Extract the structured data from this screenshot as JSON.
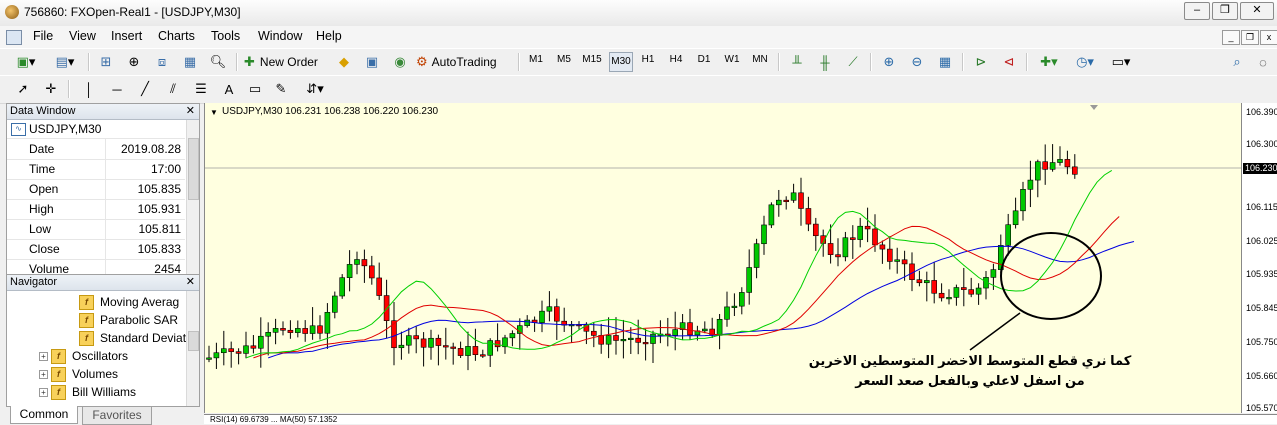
{
  "window": {
    "title": "756860: FXOpen-Real1 - [USDJPY,M30]"
  },
  "menu": [
    "File",
    "View",
    "Insert",
    "Charts",
    "Tools",
    "Window",
    "Help"
  ],
  "toolbar": {
    "new_order": "New Order",
    "autotrading": "AutoTrading"
  },
  "timeframes": [
    "M1",
    "M5",
    "M15",
    "M30",
    "H1",
    "H4",
    "D1",
    "W1",
    "MN"
  ],
  "selected_timeframe": "M30",
  "drawing_tools": {
    "text": "A",
    "arrow_down_glyph": "▾"
  },
  "data_window": {
    "title": "Data Window",
    "symbol": "USDJPY,M30",
    "rows": [
      {
        "label": "Date",
        "value": "2019.08.28"
      },
      {
        "label": "Time",
        "value": "17:00"
      },
      {
        "label": "Open",
        "value": "105.835"
      },
      {
        "label": "High",
        "value": "105.931"
      },
      {
        "label": "Low",
        "value": "105.811"
      },
      {
        "label": "Close",
        "value": "105.833"
      },
      {
        "label": "Volume",
        "value": "2454"
      }
    ]
  },
  "navigator": {
    "title": "Navigator",
    "items": [
      "Moving Averag",
      "Parabolic SAR",
      "Standard Deviat",
      "Oscillators",
      "Volumes",
      "Bill Williams"
    ],
    "tabs": [
      "Common",
      "Favorites"
    ]
  },
  "chart": {
    "info": "USDJPY,M30  106.231 106.238 106.220 106.230",
    "price_labels": [
      "106.390",
      "106.300",
      "106.230",
      "106.115",
      "106.025",
      "105.935",
      "105.845",
      "105.750",
      "105.660",
      "105.570"
    ],
    "current_price": "106.230",
    "annotation_line1": "كما نري قطع المتوسط الاخضر المتوسطين الاخرين",
    "annotation_line2": "من اسفل لاعلي وبالفعل صعد السعر",
    "rsi_strip": "RSI(14) 69.6739 ... MA(50) 57.1352"
  },
  "colors": {
    "bull": "#00c800",
    "bear": "#ff0000",
    "ma_fast": "#00d000",
    "ma_mid": "#e00000",
    "ma_slow": "#0000e0",
    "chart_bg": "#ffffe0"
  }
}
